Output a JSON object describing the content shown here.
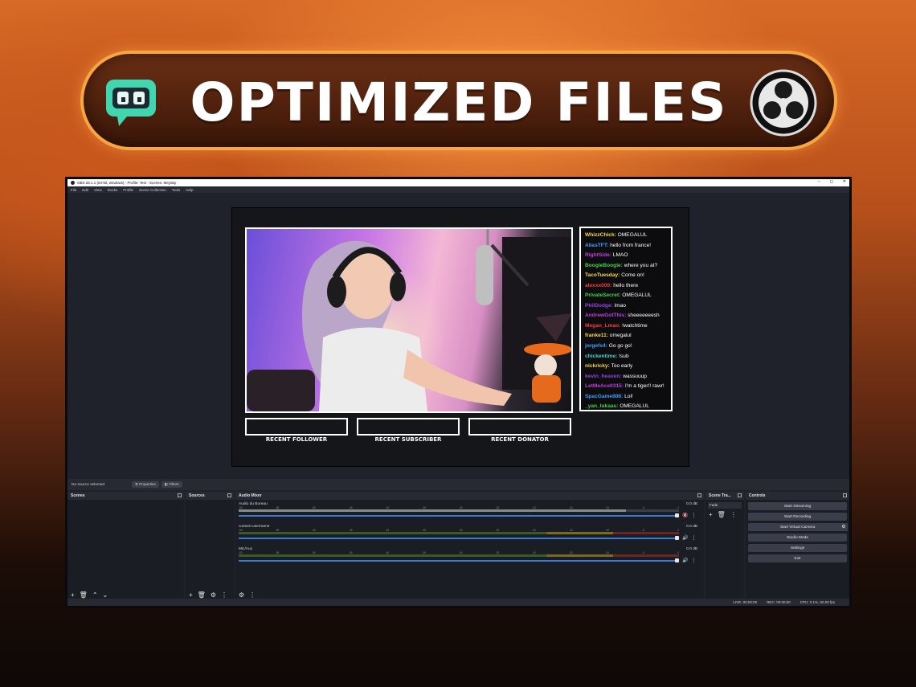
{
  "banner": {
    "title": "OPTIMIZED FILES"
  },
  "window": {
    "title": "OBS 28.1.1 (64-bit, windows) - Profile: Test - Scenes: Meyday",
    "controls": [
      "–",
      "◻",
      "✕"
    ],
    "menu": [
      "File",
      "Edit",
      "View",
      "Docks",
      "Profile",
      "Scene Collection",
      "Tools",
      "Help"
    ]
  },
  "chat": [
    {
      "user": "WhizzChick:",
      "text": " OMEGALUL",
      "color": "#f6d84a"
    },
    {
      "user": "AliasTFT:",
      "text": " hello from france!",
      "color": "#3aa0ff"
    },
    {
      "user": "RightSide:",
      "text": " LMAO",
      "color": "#c03fe0"
    },
    {
      "user": "BoogieBoogie:",
      "text": " where you at?",
      "color": "#3fd54a"
    },
    {
      "user": "TacoTuesday:",
      "text": " Come on!",
      "color": "#f6d84a"
    },
    {
      "user": "alexxx000:",
      "text": " hello there",
      "color": "#ff3b3b"
    },
    {
      "user": "PrivateSecret:",
      "text": " OMEGALUL",
      "color": "#3fd54a"
    },
    {
      "user": "PhilDodge:",
      "text": " lmao",
      "color": "#9b3fe0"
    },
    {
      "user": "AndrewGotThis:",
      "text": " sheeeeeeesh",
      "color": "#c03fe0"
    },
    {
      "user": "Megan_Lmao:",
      "text": " !watchtime",
      "color": "#ff3b3b"
    },
    {
      "user": "franke11:",
      "text": " omegalul",
      "color": "#f6d84a"
    },
    {
      "user": "jorgefs4:",
      "text": " Go go go!",
      "color": "#3aa0ff"
    },
    {
      "user": "chickentime:",
      "text": " !sub",
      "color": "#3fd5c8"
    },
    {
      "user": "nickricky:",
      "text": " Too early",
      "color": "#f6d84a"
    },
    {
      "user": "kevin_heaven:",
      "text": " wassuuup",
      "color": "#9b3fe0"
    },
    {
      "user": "LetMeAce0315:",
      "text": " I'm a tiger!! rawr!",
      "color": "#c03fe0"
    },
    {
      "user": "SpacGame808:",
      "text": " Lol!",
      "color": "#3aa0ff"
    },
    {
      "user": "_yan_lukaas:",
      "text": " OMEGALUL",
      "color": "#3fd54a"
    }
  ],
  "alerts": [
    "RECENT FOLLOWER",
    "RECENT SUBSCRIBER",
    "RECENT DONATOR"
  ],
  "source_bar": {
    "selected": "No source selected",
    "properties": "Properties",
    "filters": "Filters"
  },
  "docks": {
    "scenes": "Scenes",
    "sources": "Sources",
    "mixer": "Audio Mixer",
    "transitions": "Scene Tra...",
    "controls": "Controls"
  },
  "mixer_channels": [
    {
      "name": "Audio du Bureau",
      "db": "0.0 dB",
      "active": false,
      "level": 0.88
    },
    {
      "name": "custom-username",
      "db": "0.0 dB",
      "active": true
    },
    {
      "name": "Mic/Aux",
      "db": "0.0 dB",
      "active": true
    }
  ],
  "meter_scale": [
    "-60",
    "-55",
    "-50",
    "-45",
    "-40",
    "-35",
    "-30",
    "-25",
    "-20",
    "-15",
    "-10",
    "-5",
    "0"
  ],
  "transition_value": "Fade",
  "controls": [
    "Start Streaming",
    "Start Recording",
    "Start Virtual Camera",
    "Studio Mode",
    "Settings",
    "Exit"
  ],
  "status": {
    "live": "LIVE: 00:00:00",
    "rec": "REC: 00:00:00",
    "cpu": "CPU: 0.1%, 60.00 fps"
  }
}
